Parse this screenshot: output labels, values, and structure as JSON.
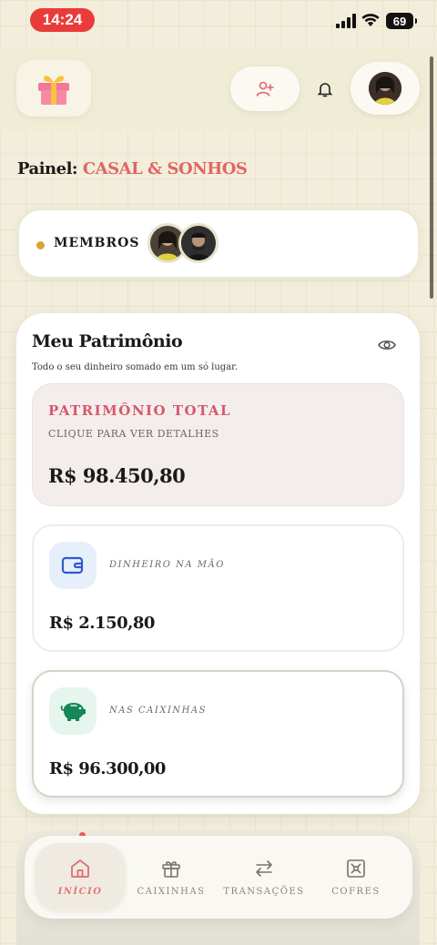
{
  "status_bar": {
    "time": "14:24",
    "battery": "69"
  },
  "header": {
    "logo_icon": "gift-icon",
    "add_member_icon": "user-plus-icon",
    "notifications_icon": "bell-icon",
    "profile_icon": "avatar"
  },
  "panel": {
    "prefix": "Painel:",
    "name": "CASAL & SONHOS",
    "accent_color": "#e06666"
  },
  "members": {
    "label": "MEMBROS",
    "count": 2
  },
  "patrimonio": {
    "title": "Meu Patrimônio",
    "subtitle": "Todo o seu dinheiro somado em um só lugar.",
    "total": {
      "label": "PATRIMÔNIO TOTAL",
      "hint": "CLIQUE PARA VER DETALHES",
      "value": "R$ 98.450,80"
    },
    "cash": {
      "label": "DINHEIRO NA MÃO",
      "value": "R$ 2.150,80",
      "icon": "wallet-icon"
    },
    "boxes": {
      "label": "NAS CAIXINHAS",
      "value": "R$ 96.300,00",
      "icon": "piggy-bank-icon"
    }
  },
  "nav": {
    "items": [
      {
        "label": "INÍCIO",
        "icon": "home-icon",
        "active": true
      },
      {
        "label": "CAIXINHAS",
        "icon": "gift-icon",
        "active": false
      },
      {
        "label": "TRANSAÇÕES",
        "icon": "arrows-swap-icon",
        "active": false
      },
      {
        "label": "COFRES",
        "icon": "vault-icon",
        "active": false
      }
    ]
  }
}
